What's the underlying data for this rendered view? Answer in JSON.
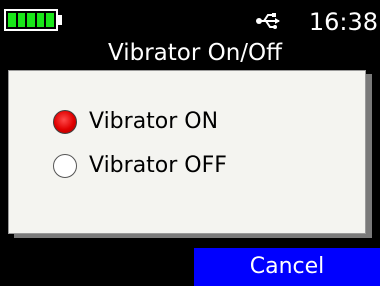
{
  "status_bar": {
    "battery_level_bars": 5,
    "battery_icon": "battery-full-icon",
    "usb_icon": "usb-icon",
    "time": "16:38"
  },
  "title": "Vibrator On/Off",
  "options": [
    {
      "label": "Vibrator ON",
      "selected": true
    },
    {
      "label": "Vibrator OFF",
      "selected": false
    }
  ],
  "cancel_label": "Cancel",
  "colors": {
    "background": "#000000",
    "dialog": "#f4f4f0",
    "battery_fill": "#19e619",
    "radio_selected": "#e00000",
    "cancel_button": "#0000ff"
  }
}
